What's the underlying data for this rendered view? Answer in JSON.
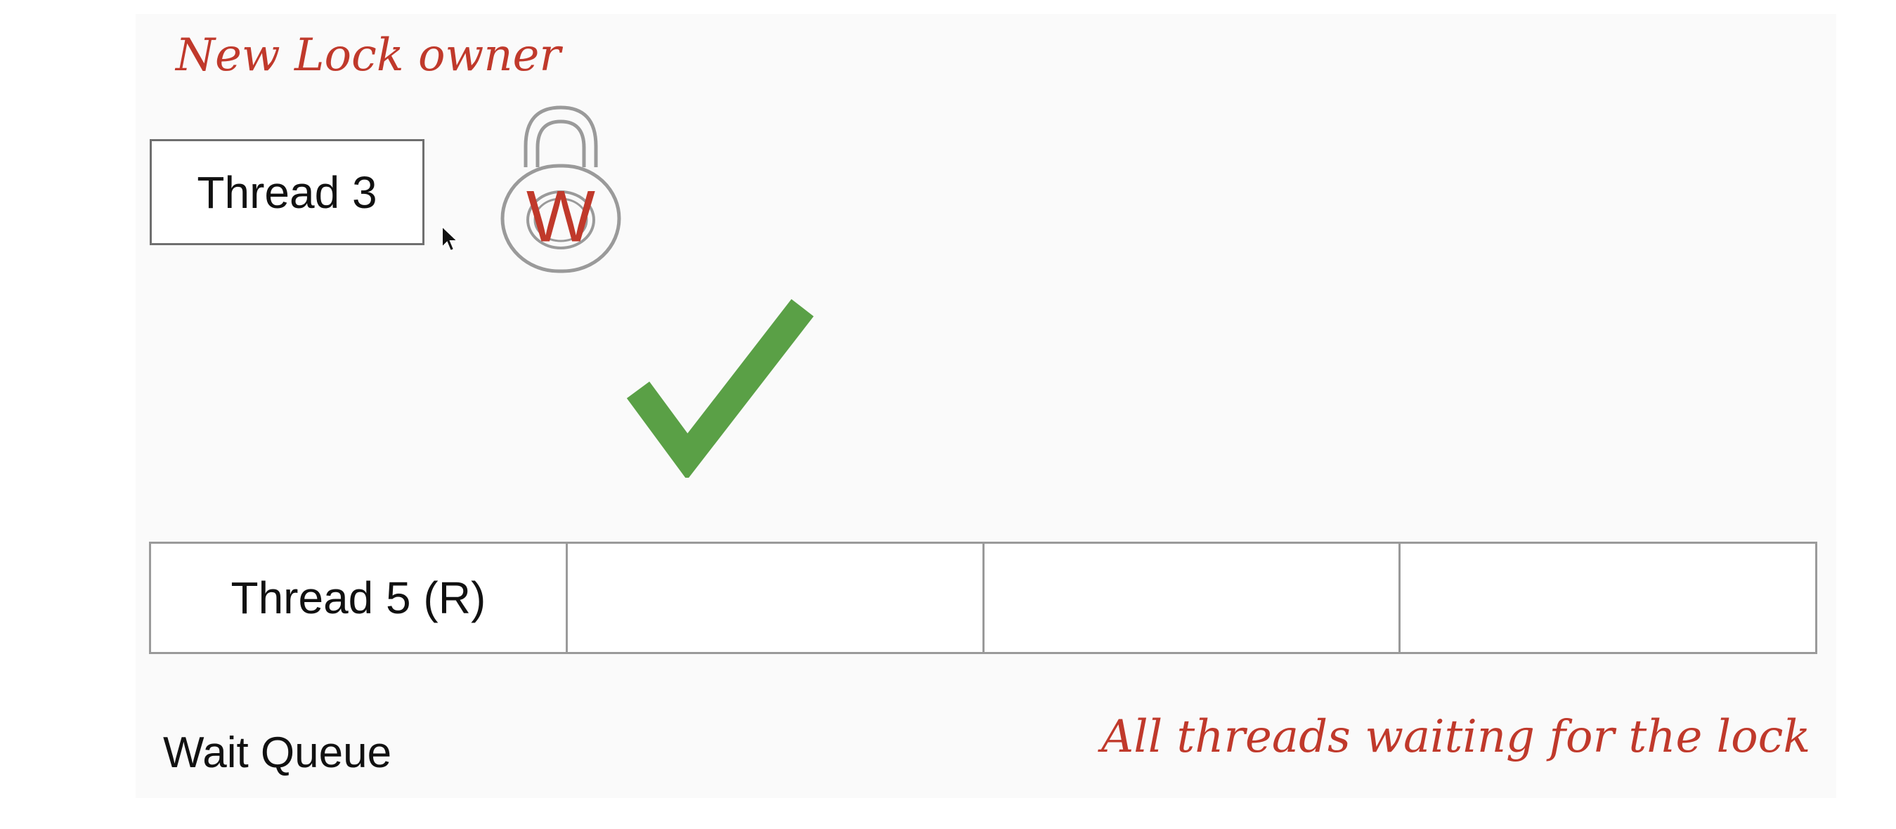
{
  "annotations": {
    "owner": "New Lock owner",
    "queue": "All threads waiting for the lock"
  },
  "owner": {
    "label": "Thread 3",
    "lock_letter": "W"
  },
  "wait_queue": {
    "label": "Wait Queue",
    "slots": [
      "Thread 5 (R)",
      "",
      "",
      ""
    ]
  },
  "icons": {
    "lock": "padlock-icon",
    "check": "checkmark-icon",
    "cursor": "mouse-cursor-icon"
  },
  "colors": {
    "annotation": "#c0392b",
    "lock_letter": "#c0392b",
    "check": "#5aa046"
  }
}
